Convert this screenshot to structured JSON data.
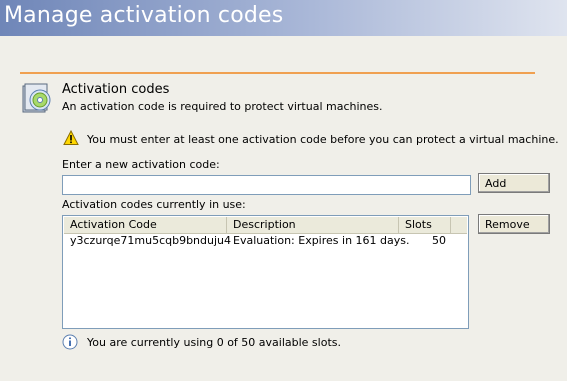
{
  "window": {
    "title": "Manage activation codes"
  },
  "section": {
    "icon": "cd-box-icon",
    "title": "Activation codes",
    "description": "An activation code is required to protect virtual machines."
  },
  "warning": {
    "icon": "warning-icon",
    "text": "You must enter at least one activation code before you can protect a virtual machine."
  },
  "new_code": {
    "label": "Enter a new activation code:",
    "value": "",
    "add_label": "Add"
  },
  "codes_in_use": {
    "label": "Activation codes currently in use:",
    "columns": [
      "Activation Code",
      "Description",
      "Slots"
    ],
    "rows": [
      {
        "code": "y3czurqe71mu5cqb9bnduju4",
        "description": "Evaluation: Expires in 161 days.",
        "slots": "50"
      }
    ],
    "remove_label": "Remove"
  },
  "status": {
    "icon": "info-icon",
    "text": "You are currently using 0 of 50 available slots."
  },
  "colors": {
    "accent_line": "#f0a050",
    "title_gradient_start": "#6f86b8"
  }
}
